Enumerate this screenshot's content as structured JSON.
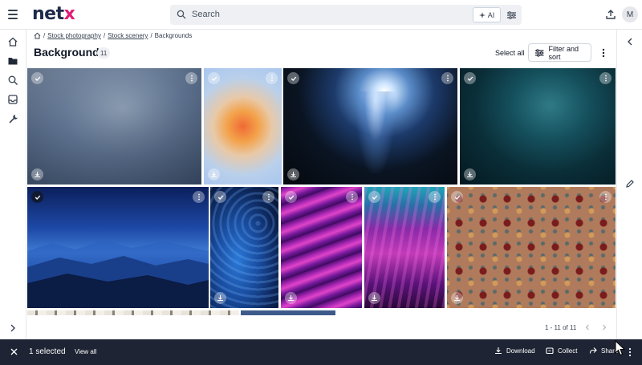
{
  "header": {
    "logo_main": "net",
    "logo_accent": "x",
    "search_placeholder": "Search",
    "ai_label": "AI",
    "avatar_initial": "M"
  },
  "breadcrumb": {
    "items": [
      "Stock photography",
      "Stock scenery",
      "Backgrounds"
    ],
    "sep": "/"
  },
  "page": {
    "title": "Backgrounds",
    "count": "11",
    "select_all": "Select all",
    "filter_label": "Filter and sort"
  },
  "tiles": [
    {
      "name": "tile-stormy-sky",
      "checked": false
    },
    {
      "name": "tile-orange-blur",
      "checked": false
    },
    {
      "name": "tile-cave-light",
      "checked": false
    },
    {
      "name": "tile-underwater-teal",
      "checked": false
    },
    {
      "name": "tile-blue-mountains",
      "checked": true
    },
    {
      "name": "tile-blue-feathers",
      "checked": false
    },
    {
      "name": "tile-purple-waves",
      "checked": false
    },
    {
      "name": "tile-teal-magenta-wave",
      "checked": false
    },
    {
      "name": "tile-floral-pattern",
      "checked": false
    }
  ],
  "pagination": {
    "label": "1 - 11 of 11"
  },
  "bottom_bar": {
    "selected_label": "1 selected",
    "view_all": "View all",
    "download": "Download",
    "collect": "Collect",
    "share": "Share"
  }
}
